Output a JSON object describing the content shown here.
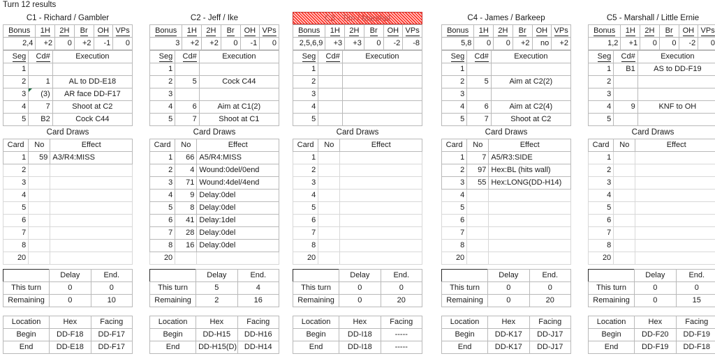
{
  "title": "Turn 12 results",
  "labels": {
    "card_draws": "Card Draws",
    "bonus_headers": [
      "Bonus",
      "1H",
      "2H",
      "Br",
      "OH",
      "VPs"
    ],
    "exec_headers": [
      "Seg",
      "Cd#",
      "Execution"
    ],
    "cards_headers": [
      "Card",
      "No",
      "Effect"
    ],
    "de_headers": [
      "",
      "Delay",
      "End."
    ],
    "de_rows": [
      "This turn",
      "Remaining"
    ],
    "loc_headers": [
      "Location",
      "Hex",
      "Facing"
    ],
    "loc_rows": [
      "Begin",
      "End"
    ],
    "seg_numbers": [
      "1",
      "2",
      "3",
      "4",
      "5"
    ],
    "card_numbers": [
      "1",
      "2",
      "3",
      "4",
      "5",
      "6",
      "7",
      "8",
      "20"
    ]
  },
  "colors": {
    "grid": "#b9b9b9",
    "outer": "#2b2b2b",
    "dead_fill": "#ff3b30",
    "dead_text": "#c0504d",
    "comment_marker": "#1d6f42"
  },
  "panels": [
    {
      "name": "C1 - Richard / Gambler",
      "status": "alive",
      "bonus": [
        "2,4",
        "+2",
        "0",
        "+2",
        "-1",
        "0"
      ],
      "execution": [
        {
          "seg": "1",
          "cd": "",
          "exec": "",
          "comment": false
        },
        {
          "seg": "2",
          "cd": "1",
          "exec": "AL to DD-E18",
          "comment": false
        },
        {
          "seg": "3",
          "cd": "(3)",
          "exec": "AR face DD-F17",
          "comment": true
        },
        {
          "seg": "4",
          "cd": "7",
          "exec": "Shoot at C2",
          "comment": false
        },
        {
          "seg": "5",
          "cd": "B2",
          "exec": "Cock C44",
          "comment": false
        }
      ],
      "cards": [
        {
          "card": "1",
          "no": "59",
          "eff": "A3/R4:MISS"
        },
        {
          "card": "2",
          "no": "",
          "eff": ""
        },
        {
          "card": "3",
          "no": "",
          "eff": ""
        },
        {
          "card": "4",
          "no": "",
          "eff": ""
        },
        {
          "card": "5",
          "no": "",
          "eff": ""
        },
        {
          "card": "6",
          "no": "",
          "eff": ""
        },
        {
          "card": "7",
          "no": "",
          "eff": ""
        },
        {
          "card": "8",
          "no": "",
          "eff": ""
        },
        {
          "card": "20",
          "no": "",
          "eff": ""
        }
      ],
      "delay_end": {
        "this_turn": {
          "delay": "0",
          "end": "0"
        },
        "remaining": {
          "delay": "0",
          "end": "10"
        }
      },
      "location": {
        "begin": {
          "hex": "DD-F18",
          "facing": "DD-F17"
        },
        "end": {
          "hex": "DD-E18",
          "facing": "DD-F17"
        }
      }
    },
    {
      "name": "C2 - Jeff / Ike",
      "status": "alive",
      "bonus": [
        "3",
        "+2",
        "+2",
        "0",
        "-1",
        "0"
      ],
      "execution": [
        {
          "seg": "1",
          "cd": "",
          "exec": "",
          "comment": false
        },
        {
          "seg": "2",
          "cd": "5",
          "exec": "Cock C44",
          "comment": false
        },
        {
          "seg": "3",
          "cd": "",
          "exec": "",
          "comment": false
        },
        {
          "seg": "4",
          "cd": "6",
          "exec": "Aim at C1(2)",
          "comment": false
        },
        {
          "seg": "5",
          "cd": "7",
          "exec": "Shoot at C1",
          "comment": false
        }
      ],
      "cards": [
        {
          "card": "1",
          "no": "66",
          "eff": "A5/R4:MISS"
        },
        {
          "card": "2",
          "no": "4",
          "eff": "Wound:0del/0end"
        },
        {
          "card": "3",
          "no": "71",
          "eff": "Wound:4del/4end"
        },
        {
          "card": "4",
          "no": "9",
          "eff": "Delay:0del"
        },
        {
          "card": "5",
          "no": "8",
          "eff": "Delay:0del"
        },
        {
          "card": "6",
          "no": "41",
          "eff": "Delay:1del"
        },
        {
          "card": "7",
          "no": "28",
          "eff": "Delay:0del"
        },
        {
          "card": "8",
          "no": "16",
          "eff": "Delay:0del"
        },
        {
          "card": "20",
          "no": "",
          "eff": ""
        }
      ],
      "delay_end": {
        "this_turn": {
          "delay": "5",
          "end": "4"
        },
        "remaining": {
          "delay": "2",
          "end": "16"
        }
      },
      "location": {
        "begin": {
          "hex": "DD-H15",
          "facing": "DD-H16"
        },
        "end": {
          "hex": "DD-H15(D)",
          "facing": "DD-H14"
        }
      }
    },
    {
      "name": "C3 - Tim / Marshal",
      "status": "dead",
      "bonus": [
        "2,5,6,9",
        "+3",
        "+3",
        "0",
        "-2",
        "-8"
      ],
      "execution": [
        {
          "seg": "1",
          "cd": "",
          "exec": "",
          "comment": false
        },
        {
          "seg": "2",
          "cd": "",
          "exec": "",
          "comment": false
        },
        {
          "seg": "3",
          "cd": "",
          "exec": "",
          "comment": false
        },
        {
          "seg": "4",
          "cd": "",
          "exec": "",
          "comment": false
        },
        {
          "seg": "5",
          "cd": "",
          "exec": "",
          "comment": false
        }
      ],
      "cards": [
        {
          "card": "1",
          "no": "",
          "eff": ""
        },
        {
          "card": "2",
          "no": "",
          "eff": ""
        },
        {
          "card": "3",
          "no": "",
          "eff": ""
        },
        {
          "card": "4",
          "no": "",
          "eff": ""
        },
        {
          "card": "5",
          "no": "",
          "eff": ""
        },
        {
          "card": "6",
          "no": "",
          "eff": ""
        },
        {
          "card": "7",
          "no": "",
          "eff": ""
        },
        {
          "card": "8",
          "no": "",
          "eff": ""
        },
        {
          "card": "20",
          "no": "",
          "eff": ""
        }
      ],
      "delay_end": {
        "this_turn": {
          "delay": "0",
          "end": "0"
        },
        "remaining": {
          "delay": "0",
          "end": "20"
        }
      },
      "location": {
        "begin": {
          "hex": "DD-I18",
          "facing": "-----"
        },
        "end": {
          "hex": "DD-I18",
          "facing": "-----"
        }
      }
    },
    {
      "name": "C4 - James / Barkeep",
      "status": "alive",
      "bonus": [
        "5,8",
        "0",
        "0",
        "+2",
        "no",
        "+2"
      ],
      "execution": [
        {
          "seg": "1",
          "cd": "",
          "exec": "",
          "comment": false
        },
        {
          "seg": "2",
          "cd": "5",
          "exec": "Aim at C2(2)",
          "comment": false
        },
        {
          "seg": "3",
          "cd": "",
          "exec": "",
          "comment": false
        },
        {
          "seg": "4",
          "cd": "6",
          "exec": "Aim at C2(4)",
          "comment": false
        },
        {
          "seg": "5",
          "cd": "7",
          "exec": "Shoot at C2",
          "comment": false
        }
      ],
      "cards": [
        {
          "card": "1",
          "no": "7",
          "eff": "A5/R3:SIDE"
        },
        {
          "card": "2",
          "no": "97",
          "eff": "Hex:BL (hits wall)"
        },
        {
          "card": "3",
          "no": "55",
          "eff": "Hex:LONG(DD-H14)"
        },
        {
          "card": "4",
          "no": "",
          "eff": ""
        },
        {
          "card": "5",
          "no": "",
          "eff": ""
        },
        {
          "card": "6",
          "no": "",
          "eff": ""
        },
        {
          "card": "7",
          "no": "",
          "eff": ""
        },
        {
          "card": "8",
          "no": "",
          "eff": ""
        },
        {
          "card": "20",
          "no": "",
          "eff": ""
        }
      ],
      "delay_end": {
        "this_turn": {
          "delay": "0",
          "end": "0"
        },
        "remaining": {
          "delay": "0",
          "end": "20"
        }
      },
      "location": {
        "begin": {
          "hex": "DD-K17",
          "facing": "DD-J17"
        },
        "end": {
          "hex": "DD-K17",
          "facing": "DD-J17"
        }
      }
    },
    {
      "name": "C5 - Marshall / Little Ernie",
      "status": "alive",
      "bonus": [
        "1,2",
        "+1",
        "0",
        "0",
        "-2",
        "0"
      ],
      "execution": [
        {
          "seg": "1",
          "cd": "B1",
          "exec": "AS to DD-F19",
          "comment": false
        },
        {
          "seg": "2",
          "cd": "",
          "exec": "",
          "comment": false
        },
        {
          "seg": "3",
          "cd": "",
          "exec": "",
          "comment": false
        },
        {
          "seg": "4",
          "cd": "9",
          "exec": "KNF to OH",
          "comment": false
        },
        {
          "seg": "5",
          "cd": "",
          "exec": "",
          "comment": false
        }
      ],
      "cards": [
        {
          "card": "1",
          "no": "",
          "eff": ""
        },
        {
          "card": "2",
          "no": "",
          "eff": ""
        },
        {
          "card": "3",
          "no": "",
          "eff": ""
        },
        {
          "card": "4",
          "no": "",
          "eff": ""
        },
        {
          "card": "5",
          "no": "",
          "eff": ""
        },
        {
          "card": "6",
          "no": "",
          "eff": ""
        },
        {
          "card": "7",
          "no": "",
          "eff": ""
        },
        {
          "card": "8",
          "no": "",
          "eff": ""
        },
        {
          "card": "20",
          "no": "",
          "eff": ""
        }
      ],
      "delay_end": {
        "this_turn": {
          "delay": "0",
          "end": "0"
        },
        "remaining": {
          "delay": "0",
          "end": "15"
        }
      },
      "location": {
        "begin": {
          "hex": "DD-F20",
          "facing": "DD-F19"
        },
        "end": {
          "hex": "DD-F19",
          "facing": "DD-F18"
        }
      }
    }
  ]
}
